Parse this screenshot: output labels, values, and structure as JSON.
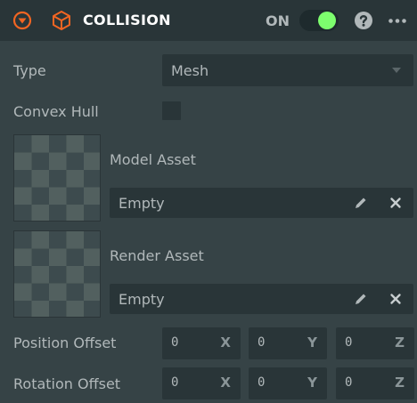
{
  "header": {
    "title": "COLLISION",
    "toggle_label": "ON",
    "toggle_state": true,
    "accent_color": "#f26522",
    "toggle_color": "#7dfe6e",
    "icons": [
      "collapse-icon",
      "cube-icon",
      "help-icon",
      "more-icon"
    ]
  },
  "fields": {
    "type_label": "Type",
    "type_value": "Mesh",
    "convex_hull_label": "Convex Hull",
    "convex_hull_checked": false,
    "model_asset_label": "Model Asset",
    "model_asset_value": "Empty",
    "render_asset_label": "Render Asset",
    "render_asset_value": "Empty",
    "position_offset_label": "Position Offset",
    "position_offset": {
      "x": "0",
      "y": "0",
      "z": "0"
    },
    "rotation_offset_label": "Rotation Offset",
    "rotation_offset": {
      "x": "0",
      "y": "0",
      "z": "0"
    },
    "axes": {
      "x": "X",
      "y": "Y",
      "z": "Z"
    }
  }
}
